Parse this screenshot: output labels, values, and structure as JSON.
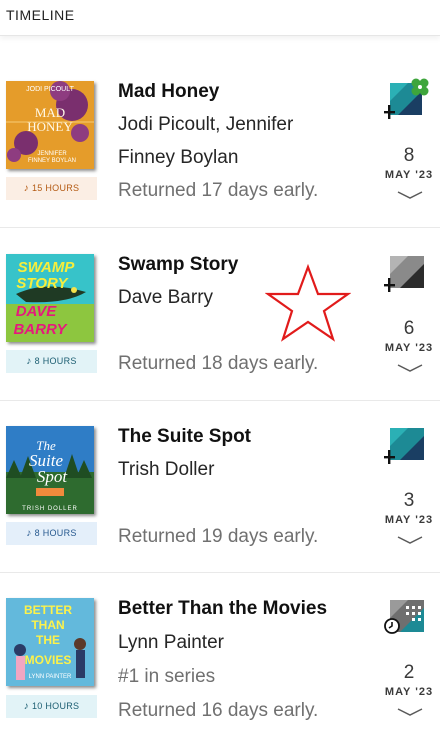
{
  "header": {
    "title": "TIMELINE"
  },
  "items": [
    {
      "title": "Mad Honey",
      "author_lines": [
        "Jodi Picoult, Jennifer",
        "Finney Boylan"
      ],
      "note": "",
      "status": "Returned 17 days early.",
      "duration": "15 HOURS",
      "day": "8",
      "month": "MAY '23",
      "cover": {
        "line1": "JODI PICOULT",
        "line2": "MAD",
        "line3": "HONEY",
        "line4": "JENNIFER",
        "line5": "FINNEY BOYLAN",
        "color": "#e59c2a"
      },
      "action_icon": "borrow-clover-icon"
    },
    {
      "title": "Swamp Story",
      "author_lines": [
        "Dave Barry"
      ],
      "note": "",
      "status": "Returned 18 days early.",
      "duration": "8 HOURS",
      "day": "6",
      "month": "MAY '23",
      "cover": {
        "line1": "SWAMP",
        "line2": "STORY",
        "line3": "DAVE",
        "line4": "BARRY",
        "color": "#37c3c9"
      },
      "action_icon": "borrow-gray-icon"
    },
    {
      "title": "The Suite Spot",
      "author_lines": [
        "Trish Doller"
      ],
      "note": "",
      "status": "Returned 19 days early.",
      "duration": "8 HOURS",
      "day": "3",
      "month": "MAY '23",
      "cover": {
        "line1": "The",
        "line2": "Suite",
        "line3": "Spot",
        "line4": "TRISH DOLLER",
        "color": "#2f7dc6"
      },
      "action_icon": "borrow-navy-icon"
    },
    {
      "title": "Better Than the Movies",
      "author_lines": [
        "Lynn Painter"
      ],
      "note": "#1 in series",
      "status": "Returned 16 days early.",
      "duration": "10 HOURS",
      "day": "2",
      "month": "MAY '23",
      "cover": {
        "line1": "BETTER",
        "line2": "THAN",
        "line3": "THE",
        "line4": "MOVIES",
        "line5": "LYNN PAINTER",
        "color": "#63b9dc"
      },
      "action_icon": "hold-clock-icon"
    }
  ],
  "colors": {
    "star": "#e11b1b",
    "muted_text": "#707070"
  }
}
